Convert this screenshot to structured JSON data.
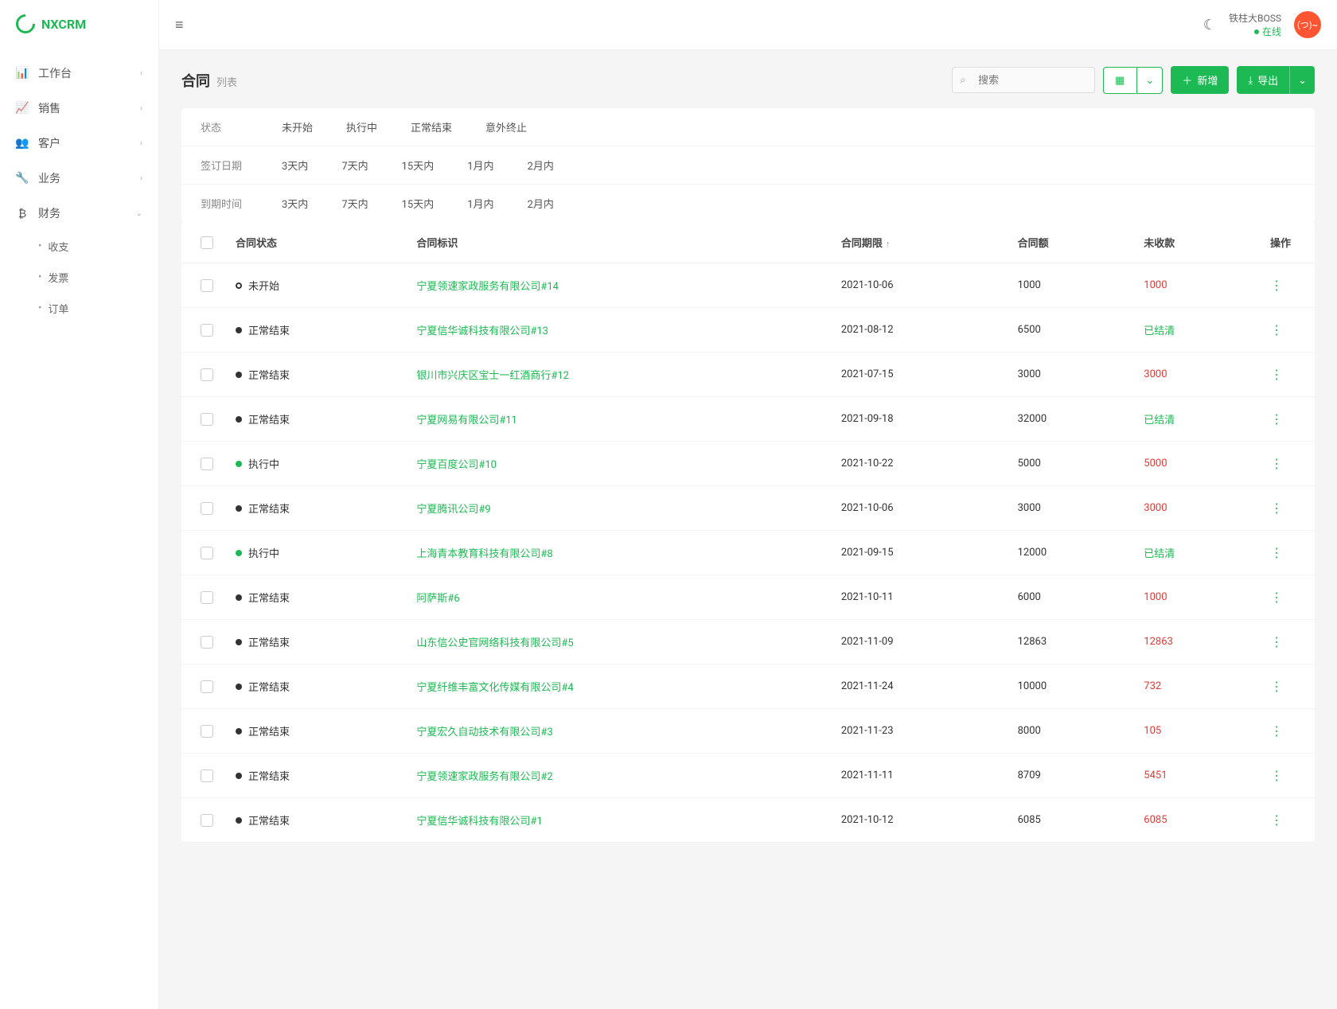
{
  "brand": "NXCRM",
  "sidebar": {
    "items": [
      {
        "icon": "📊",
        "label": "工作台",
        "expandable": true
      },
      {
        "icon": "📈",
        "label": "销售",
        "expandable": true
      },
      {
        "icon": "👥",
        "label": "客户",
        "expandable": true
      },
      {
        "icon": "🔧",
        "label": "业务",
        "expandable": true
      },
      {
        "icon": "₿",
        "label": "财务",
        "expandable": true,
        "expanded": true
      }
    ],
    "subitems": [
      "收支",
      "发票",
      "订单"
    ]
  },
  "topbar": {
    "user_name": "铁柱大BOSS",
    "user_status": "在线",
    "avatar_text": "(つ)~"
  },
  "page": {
    "title": "合同",
    "subtitle": "列表"
  },
  "search": {
    "placeholder": "搜索"
  },
  "buttons": {
    "add": "新增",
    "export": "导出"
  },
  "filters": {
    "status": {
      "label": "状态",
      "options": [
        "未开始",
        "执行中",
        "正常结束",
        "意外终止"
      ]
    },
    "sign_date": {
      "label": "签订日期",
      "options": [
        "3天内",
        "7天内",
        "15天内",
        "1月内",
        "2月内"
      ]
    },
    "expire": {
      "label": "到期时间",
      "options": [
        "3天内",
        "7天内",
        "15天内",
        "1月内",
        "2月内"
      ]
    }
  },
  "table": {
    "headers": {
      "status": "合同状态",
      "identifier": "合同标识",
      "deadline": "合同期限",
      "amount": "合同额",
      "unpaid": "未收款",
      "action": "操作"
    },
    "rows": [
      {
        "status": "未开始",
        "dot": "outline",
        "identifier": "宁夏领速家政服务有限公司#14",
        "deadline": "2021-10-06",
        "amount": "1000",
        "unpaid": "1000",
        "unpaid_type": "red"
      },
      {
        "status": "正常结束",
        "dot": "gray",
        "identifier": "宁夏信华诚科技有限公司#13",
        "deadline": "2021-08-12",
        "amount": "6500",
        "unpaid": "已结清",
        "unpaid_type": "green"
      },
      {
        "status": "正常结束",
        "dot": "gray",
        "identifier": "银川市兴庆区宝士一红酒商行#12",
        "deadline": "2021-07-15",
        "amount": "3000",
        "unpaid": "3000",
        "unpaid_type": "red"
      },
      {
        "status": "正常结束",
        "dot": "gray",
        "identifier": "宁夏网易有限公司#11",
        "deadline": "2021-09-18",
        "amount": "32000",
        "unpaid": "已结清",
        "unpaid_type": "green"
      },
      {
        "status": "执行中",
        "dot": "green",
        "identifier": "宁夏百度公司#10",
        "deadline": "2021-10-22",
        "amount": "5000",
        "unpaid": "5000",
        "unpaid_type": "red"
      },
      {
        "status": "正常结束",
        "dot": "gray",
        "identifier": "宁夏腾讯公司#9",
        "deadline": "2021-10-06",
        "amount": "3000",
        "unpaid": "3000",
        "unpaid_type": "red"
      },
      {
        "status": "执行中",
        "dot": "green",
        "identifier": "上海青本教育科技有限公司#8",
        "deadline": "2021-09-15",
        "amount": "12000",
        "unpaid": "已结清",
        "unpaid_type": "green"
      },
      {
        "status": "正常结束",
        "dot": "gray",
        "identifier": "阿萨斯#6",
        "deadline": "2021-10-11",
        "amount": "6000",
        "unpaid": "1000",
        "unpaid_type": "red"
      },
      {
        "status": "正常结束",
        "dot": "gray",
        "identifier": "山东信公史官网络科技有限公司#5",
        "deadline": "2021-11-09",
        "amount": "12863",
        "unpaid": "12863",
        "unpaid_type": "red"
      },
      {
        "status": "正常结束",
        "dot": "gray",
        "identifier": "宁夏纤维丰富文化传媒有限公司#4",
        "deadline": "2021-11-24",
        "amount": "10000",
        "unpaid": "732",
        "unpaid_type": "red"
      },
      {
        "status": "正常结束",
        "dot": "gray",
        "identifier": "宁夏宏久自动技术有限公司#3",
        "deadline": "2021-11-23",
        "amount": "8000",
        "unpaid": "105",
        "unpaid_type": "red"
      },
      {
        "status": "正常结束",
        "dot": "gray",
        "identifier": "宁夏领速家政服务有限公司#2",
        "deadline": "2021-11-11",
        "amount": "8709",
        "unpaid": "5451",
        "unpaid_type": "red"
      },
      {
        "status": "正常结束",
        "dot": "gray",
        "identifier": "宁夏信华诚科技有限公司#1",
        "deadline": "2021-10-12",
        "amount": "6085",
        "unpaid": "6085",
        "unpaid_type": "red"
      }
    ]
  }
}
